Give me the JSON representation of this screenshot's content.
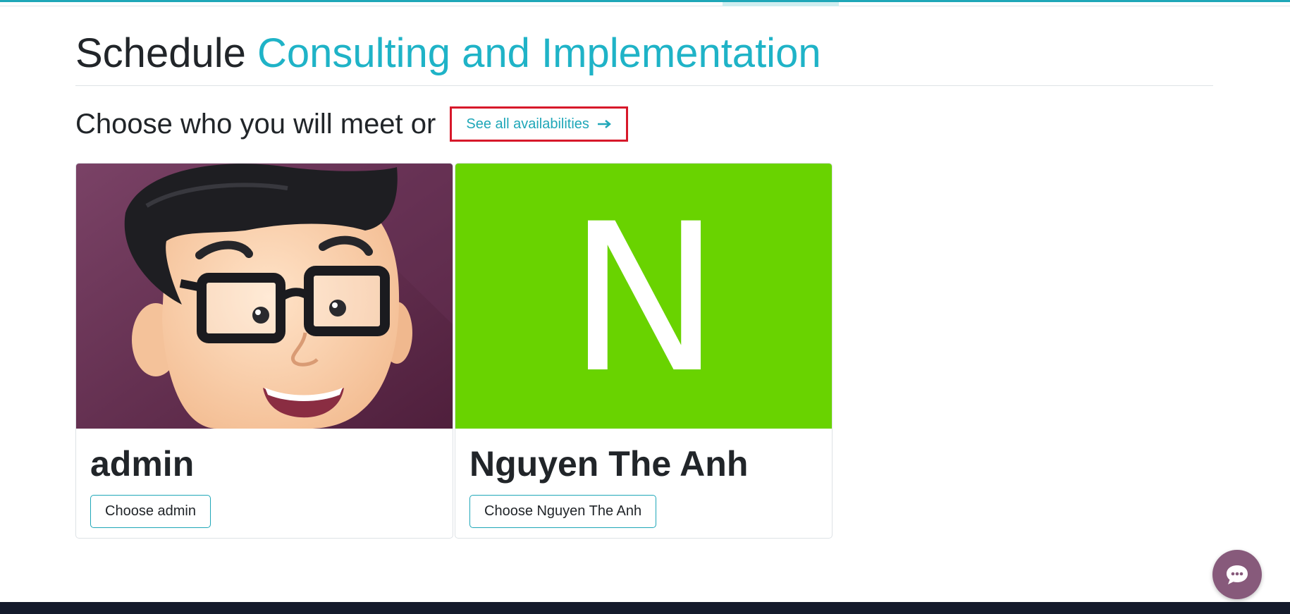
{
  "page": {
    "title_prefix": "Schedule",
    "title_accent": "Consulting and Implementation",
    "subtitle": "Choose who you will meet or",
    "see_all_label": "See all availabilities"
  },
  "staff": [
    {
      "name": "admin",
      "button_label": "Choose admin",
      "avatar": "cartoon-man-avatar"
    },
    {
      "name": "Nguyen The Anh",
      "button_label": "Choose Nguyen The Anh",
      "avatar_initial": "N",
      "avatar_color": "#69d300"
    }
  ],
  "colors": {
    "accent": "#1fb3c7",
    "highlight_border": "#d7182a",
    "chat_bubble": "#875a7b",
    "footer": "#141a2b"
  },
  "icons": {
    "see_all": "arrow-right-icon",
    "chat": "chat-bubble-icon"
  }
}
